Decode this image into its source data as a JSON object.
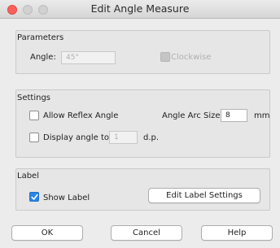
{
  "window": {
    "title": "Edit Angle Measure"
  },
  "parameters": {
    "group_label": "Parameters",
    "angle_label": "Angle:",
    "angle_value": "45°",
    "clockwise_label": "Clockwise",
    "clockwise_checked": false,
    "clockwise_disabled": true
  },
  "settings": {
    "group_label": "Settings",
    "allow_reflex_label": "Allow Reflex Angle",
    "allow_reflex_checked": false,
    "arc_size_label": "Angle Arc Size:",
    "arc_size_value": "8",
    "arc_size_unit": "mm",
    "display_angle_label": "Display angle to:",
    "display_angle_checked": false,
    "display_angle_value": "1",
    "display_angle_unit": "d.p."
  },
  "label": {
    "group_label": "Label",
    "show_label": "Show Label",
    "show_label_checked": true,
    "edit_settings_button": "Edit Label Settings"
  },
  "footer": {
    "ok_button": "OK",
    "cancel_button": "Cancel",
    "help_button": "Help"
  },
  "colors": {
    "accent": "#2a86e8",
    "close_light": "#fc605c",
    "inactive_light": "#d1d1d1"
  }
}
